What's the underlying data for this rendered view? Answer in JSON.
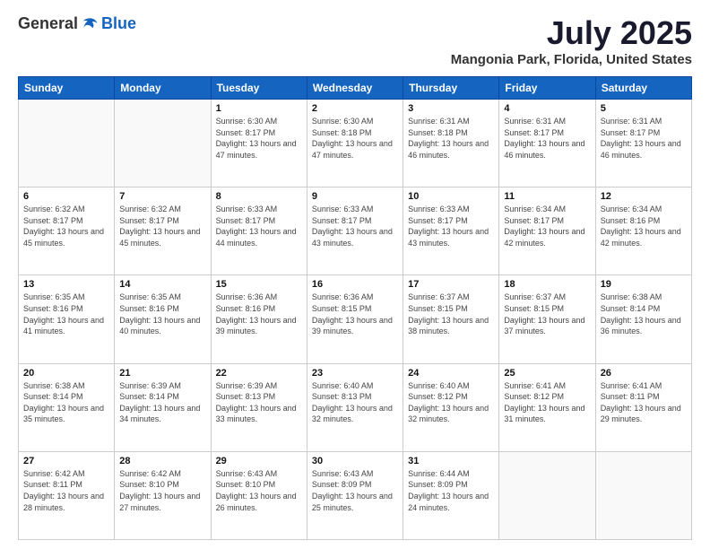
{
  "header": {
    "logo_general": "General",
    "logo_blue": "Blue",
    "title": "July 2025",
    "subtitle": "Mangonia Park, Florida, United States"
  },
  "weekdays": [
    "Sunday",
    "Monday",
    "Tuesday",
    "Wednesday",
    "Thursday",
    "Friday",
    "Saturday"
  ],
  "weeks": [
    [
      {
        "day": "",
        "info": ""
      },
      {
        "day": "",
        "info": ""
      },
      {
        "day": "1",
        "info": "Sunrise: 6:30 AM\nSunset: 8:17 PM\nDaylight: 13 hours and 47 minutes."
      },
      {
        "day": "2",
        "info": "Sunrise: 6:30 AM\nSunset: 8:18 PM\nDaylight: 13 hours and 47 minutes."
      },
      {
        "day": "3",
        "info": "Sunrise: 6:31 AM\nSunset: 8:18 PM\nDaylight: 13 hours and 46 minutes."
      },
      {
        "day": "4",
        "info": "Sunrise: 6:31 AM\nSunset: 8:17 PM\nDaylight: 13 hours and 46 minutes."
      },
      {
        "day": "5",
        "info": "Sunrise: 6:31 AM\nSunset: 8:17 PM\nDaylight: 13 hours and 46 minutes."
      }
    ],
    [
      {
        "day": "6",
        "info": "Sunrise: 6:32 AM\nSunset: 8:17 PM\nDaylight: 13 hours and 45 minutes."
      },
      {
        "day": "7",
        "info": "Sunrise: 6:32 AM\nSunset: 8:17 PM\nDaylight: 13 hours and 45 minutes."
      },
      {
        "day": "8",
        "info": "Sunrise: 6:33 AM\nSunset: 8:17 PM\nDaylight: 13 hours and 44 minutes."
      },
      {
        "day": "9",
        "info": "Sunrise: 6:33 AM\nSunset: 8:17 PM\nDaylight: 13 hours and 43 minutes."
      },
      {
        "day": "10",
        "info": "Sunrise: 6:33 AM\nSunset: 8:17 PM\nDaylight: 13 hours and 43 minutes."
      },
      {
        "day": "11",
        "info": "Sunrise: 6:34 AM\nSunset: 8:17 PM\nDaylight: 13 hours and 42 minutes."
      },
      {
        "day": "12",
        "info": "Sunrise: 6:34 AM\nSunset: 8:16 PM\nDaylight: 13 hours and 42 minutes."
      }
    ],
    [
      {
        "day": "13",
        "info": "Sunrise: 6:35 AM\nSunset: 8:16 PM\nDaylight: 13 hours and 41 minutes."
      },
      {
        "day": "14",
        "info": "Sunrise: 6:35 AM\nSunset: 8:16 PM\nDaylight: 13 hours and 40 minutes."
      },
      {
        "day": "15",
        "info": "Sunrise: 6:36 AM\nSunset: 8:16 PM\nDaylight: 13 hours and 39 minutes."
      },
      {
        "day": "16",
        "info": "Sunrise: 6:36 AM\nSunset: 8:15 PM\nDaylight: 13 hours and 39 minutes."
      },
      {
        "day": "17",
        "info": "Sunrise: 6:37 AM\nSunset: 8:15 PM\nDaylight: 13 hours and 38 minutes."
      },
      {
        "day": "18",
        "info": "Sunrise: 6:37 AM\nSunset: 8:15 PM\nDaylight: 13 hours and 37 minutes."
      },
      {
        "day": "19",
        "info": "Sunrise: 6:38 AM\nSunset: 8:14 PM\nDaylight: 13 hours and 36 minutes."
      }
    ],
    [
      {
        "day": "20",
        "info": "Sunrise: 6:38 AM\nSunset: 8:14 PM\nDaylight: 13 hours and 35 minutes."
      },
      {
        "day": "21",
        "info": "Sunrise: 6:39 AM\nSunset: 8:14 PM\nDaylight: 13 hours and 34 minutes."
      },
      {
        "day": "22",
        "info": "Sunrise: 6:39 AM\nSunset: 8:13 PM\nDaylight: 13 hours and 33 minutes."
      },
      {
        "day": "23",
        "info": "Sunrise: 6:40 AM\nSunset: 8:13 PM\nDaylight: 13 hours and 32 minutes."
      },
      {
        "day": "24",
        "info": "Sunrise: 6:40 AM\nSunset: 8:12 PM\nDaylight: 13 hours and 32 minutes."
      },
      {
        "day": "25",
        "info": "Sunrise: 6:41 AM\nSunset: 8:12 PM\nDaylight: 13 hours and 31 minutes."
      },
      {
        "day": "26",
        "info": "Sunrise: 6:41 AM\nSunset: 8:11 PM\nDaylight: 13 hours and 29 minutes."
      }
    ],
    [
      {
        "day": "27",
        "info": "Sunrise: 6:42 AM\nSunset: 8:11 PM\nDaylight: 13 hours and 28 minutes."
      },
      {
        "day": "28",
        "info": "Sunrise: 6:42 AM\nSunset: 8:10 PM\nDaylight: 13 hours and 27 minutes."
      },
      {
        "day": "29",
        "info": "Sunrise: 6:43 AM\nSunset: 8:10 PM\nDaylight: 13 hours and 26 minutes."
      },
      {
        "day": "30",
        "info": "Sunrise: 6:43 AM\nSunset: 8:09 PM\nDaylight: 13 hours and 25 minutes."
      },
      {
        "day": "31",
        "info": "Sunrise: 6:44 AM\nSunset: 8:09 PM\nDaylight: 13 hours and 24 minutes."
      },
      {
        "day": "",
        "info": ""
      },
      {
        "day": "",
        "info": ""
      }
    ]
  ]
}
